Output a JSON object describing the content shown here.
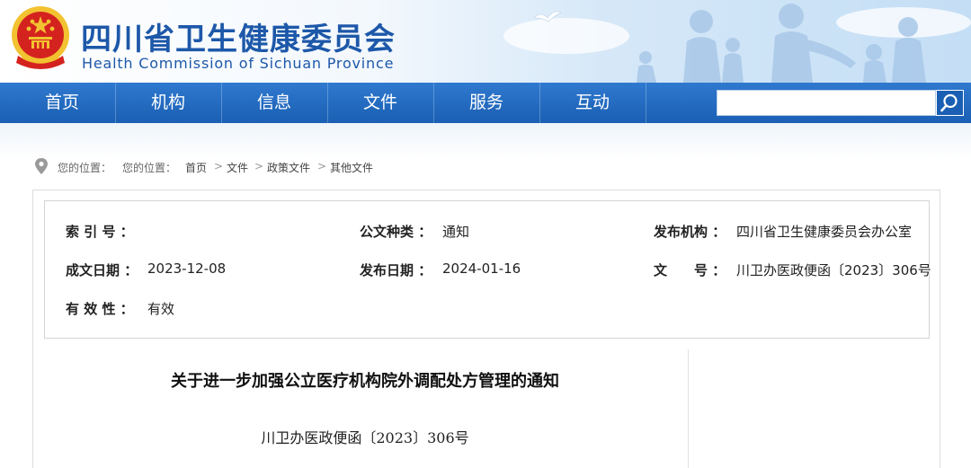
{
  "header": {
    "title_cn": "四川省卫生健康委员会",
    "title_en": "Health Commission of Sichuan Province",
    "brand_color": "#1d58a9"
  },
  "nav": {
    "items": [
      {
        "label": "首页"
      },
      {
        "label": "机构"
      },
      {
        "label": "信息"
      },
      {
        "label": "文件"
      },
      {
        "label": "服务"
      },
      {
        "label": "互动"
      }
    ],
    "search": {
      "placeholder": "",
      "value": ""
    },
    "bar_color": "#1a5fb3"
  },
  "breadcrumb": {
    "prefix1": "您的位置：",
    "prefix2": "您的位置：",
    "items": [
      "首页",
      "文件",
      "政策文件",
      "其他文件"
    ],
    "separator": ">"
  },
  "meta": {
    "index_label": "索 引 号 ：",
    "index_value": "",
    "type_label": "公文种类 ：",
    "type_value": "通知",
    "org_label": "发布机构 ：",
    "org_value": "四川省卫生健康委员会办公室",
    "created_label": "成文日期 ：",
    "created_value": "2023-12-08",
    "published_label": "发布日期 ：",
    "published_value": "2024-01-16",
    "docno_label": "文　　号 ：",
    "docno_value": "川卫办医政便函〔2023〕306号",
    "validity_label": "有 效 性 ：",
    "validity_value": "有效"
  },
  "document": {
    "title": "关于进一步加强公立医疗机构院外调配处方管理的通知",
    "number": "川卫办医政便函〔2023〕306号"
  }
}
